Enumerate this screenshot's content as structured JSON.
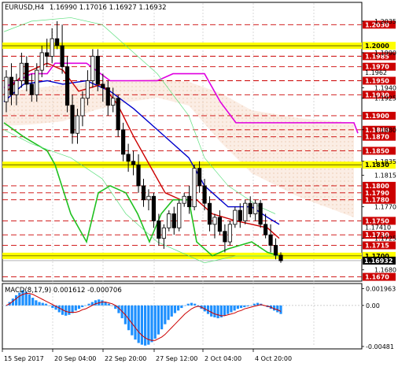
{
  "header": {
    "symbol": "EURUSD,H4",
    "ohlc": "1.16990 1.17016 1.16927 1.16932"
  },
  "price_axis": {
    "ticks": [
      "1.2035",
      "1.1990",
      "1.1940",
      "1.1925",
      "1.1880",
      "1.1835",
      "1.1815",
      "1.1770",
      "1.1725",
      "1.1680"
    ],
    "min": 1.1665,
    "max": 1.2045
  },
  "levels": {
    "red_dashed": [
      1.203,
      1.1985,
      1.197,
      1.195,
      1.193,
      1.19,
      1.188,
      1.187,
      1.185,
      1.18,
      1.179,
      1.178,
      1.175,
      1.173,
      1.1715,
      1.167
    ],
    "yellow_bands": [
      1.2,
      1.183,
      1.17
    ],
    "label_color": "#cc0000",
    "band_color": "#ffff00",
    "current_price": "1.16932",
    "current_price_value": 1.16932,
    "marker_price": "1.1962",
    "marker_price_value": 1.1962,
    "marker_price_2": "1.17410",
    "marker_price_2_value": 1.1741
  },
  "macd": {
    "label": "MACD(8,17,9) 0.001612 -0.000706",
    "axis_ticks": [
      "0.001963",
      "0.00",
      "-0.00481"
    ],
    "hist_color": "#1e90ff",
    "signal_color": "#cc0000",
    "values": [
      0.0,
      0.0004,
      0.0008,
      0.0012,
      0.0015,
      0.0018,
      0.0016,
      0.0013,
      0.0009,
      0.0006,
      0.0004,
      0.0003,
      0.0002,
      0.0,
      -0.0003,
      -0.0005,
      -0.0008,
      -0.0011,
      -0.0012,
      -0.0011,
      -0.0009,
      -0.0006,
      -0.0004,
      -0.0002,
      0.0,
      0.0002,
      0.0004,
      0.0006,
      0.0007,
      0.0006,
      0.0004,
      0.0002,
      0.0,
      -0.0004,
      -0.0009,
      -0.0015,
      -0.0022,
      -0.0029,
      -0.0035,
      -0.004,
      -0.0044,
      -0.0046,
      -0.0047,
      -0.0046,
      -0.0043,
      -0.0039,
      -0.0034,
      -0.0028,
      -0.0022,
      -0.0017,
      -0.0013,
      -0.0009,
      -0.0006,
      -0.0003,
      0.0,
      0.0002,
      0.0003,
      0.0002,
      -0.0001,
      -0.0004,
      -0.0007,
      -0.001,
      -0.0013,
      -0.0014,
      -0.0015,
      -0.0014,
      -0.0012,
      -0.001,
      -0.0008,
      -0.0006,
      -0.0004,
      -0.0003,
      -0.0002,
      -0.0001,
      0.0,
      0.0002,
      0.0003,
      0.0002,
      0.0,
      -0.0002,
      -0.0004,
      -0.0006,
      -0.0008,
      -0.001
    ],
    "signal": [
      0.0,
      0.0002,
      0.0005,
      0.0008,
      0.0011,
      0.0013,
      0.0014,
      0.0014,
      0.0013,
      0.0011,
      0.0009,
      0.0007,
      0.0005,
      0.0003,
      0.0001,
      -0.0001,
      -0.0003,
      -0.0005,
      -0.0007,
      -0.0008,
      -0.0008,
      -0.0008,
      -0.0007,
      -0.0005,
      -0.0004,
      -0.0002,
      0.0,
      0.0002,
      0.0003,
      0.0004,
      0.0004,
      0.0003,
      0.0002,
      0.0,
      -0.0003,
      -0.0007,
      -0.0011,
      -0.0016,
      -0.0021,
      -0.0026,
      -0.0031,
      -0.0035,
      -0.0038,
      -0.004,
      -0.0041,
      -0.0041,
      -0.0039,
      -0.0037,
      -0.0034,
      -0.003,
      -0.0026,
      -0.0022,
      -0.0018,
      -0.0014,
      -0.001,
      -0.0007,
      -0.0004,
      -0.0002,
      -0.0001,
      -0.0002,
      -0.0004,
      -0.0006,
      -0.0008,
      -0.001,
      -0.0011,
      -0.0012,
      -0.0012,
      -0.0011,
      -0.001,
      -0.0009,
      -0.0007,
      -0.0006,
      -0.0004,
      -0.0003,
      -0.0002,
      -0.0001,
      0.0,
      0.0001,
      0.0,
      -0.0001,
      -0.0002,
      -0.0004,
      -0.0005,
      -0.0007
    ],
    "min": -0.005,
    "max": 0.0022
  },
  "time_axis": {
    "labels": [
      "15 Sep 2017",
      "20 Sep 04:00",
      "22 Sep 20:00",
      "27 Sep 12:00",
      "2 Oct 04:00",
      "4 Oct 20:00"
    ]
  },
  "chart_data": {
    "type": "candlestick",
    "symbol": "EURUSD,H4",
    "ylim": [
      1.1665,
      1.2045
    ],
    "candles": [
      [
        1.192,
        1.1965,
        1.1905,
        1.1955
      ],
      [
        1.1955,
        1.1975,
        1.1915,
        1.193
      ],
      [
        1.193,
        1.196,
        1.1915,
        1.195
      ],
      [
        1.195,
        1.199,
        1.194,
        1.1975
      ],
      [
        1.1975,
        1.1985,
        1.1935,
        1.1945
      ],
      [
        1.1945,
        1.196,
        1.192,
        1.193
      ],
      [
        1.193,
        1.1975,
        1.192,
        1.1965
      ],
      [
        1.1965,
        1.2,
        1.1955,
        1.199
      ],
      [
        1.199,
        1.201,
        1.197,
        1.1985
      ],
      [
        1.1985,
        1.2025,
        1.1975,
        1.201
      ],
      [
        1.201,
        1.2035,
        1.1995,
        1.2
      ],
      [
        1.2,
        1.203,
        1.196,
        1.197
      ],
      [
        1.197,
        1.1985,
        1.1905,
        1.1915
      ],
      [
        1.1915,
        1.193,
        1.186,
        1.1875
      ],
      [
        1.1875,
        1.191,
        1.186,
        1.19
      ],
      [
        1.19,
        1.1935,
        1.1885,
        1.1925
      ],
      [
        1.1925,
        1.1965,
        1.1915,
        1.195
      ],
      [
        1.195,
        1.1995,
        1.194,
        1.1985
      ],
      [
        1.1985,
        1.1995,
        1.1935,
        1.1945
      ],
      [
        1.1945,
        1.196,
        1.192,
        1.194
      ],
      [
        1.194,
        1.195,
        1.19,
        1.1915
      ],
      [
        1.1915,
        1.194,
        1.1905,
        1.1925
      ],
      [
        1.1925,
        1.193,
        1.187,
        1.188
      ],
      [
        1.188,
        1.189,
        1.1835,
        1.1845
      ],
      [
        1.1845,
        1.186,
        1.182,
        1.1835
      ],
      [
        1.1835,
        1.185,
        1.1815,
        1.183
      ],
      [
        1.183,
        1.1845,
        1.179,
        1.18
      ],
      [
        1.18,
        1.181,
        1.177,
        1.178
      ],
      [
        1.178,
        1.1795,
        1.1765,
        1.1785
      ],
      [
        1.1785,
        1.179,
        1.174,
        1.175
      ],
      [
        1.175,
        1.176,
        1.1715,
        1.1725
      ],
      [
        1.1725,
        1.1745,
        1.171,
        1.174
      ],
      [
        1.174,
        1.1765,
        1.1735,
        1.176
      ],
      [
        1.176,
        1.177,
        1.173,
        1.174
      ],
      [
        1.174,
        1.178,
        1.1735,
        1.1775
      ],
      [
        1.1775,
        1.179,
        1.177,
        1.1785
      ],
      [
        1.1785,
        1.18,
        1.176,
        1.177
      ],
      [
        1.177,
        1.183,
        1.1765,
        1.1825
      ],
      [
        1.1825,
        1.1835,
        1.179,
        1.18
      ],
      [
        1.18,
        1.181,
        1.1765,
        1.1775
      ],
      [
        1.1775,
        1.1785,
        1.1735,
        1.1745
      ],
      [
        1.1745,
        1.176,
        1.1725,
        1.1755
      ],
      [
        1.1755,
        1.1765,
        1.173,
        1.1735
      ],
      [
        1.1735,
        1.1745,
        1.1705,
        1.172
      ],
      [
        1.172,
        1.175,
        1.1715,
        1.1745
      ],
      [
        1.1745,
        1.177,
        1.174,
        1.1765
      ],
      [
        1.1765,
        1.1775,
        1.174,
        1.175
      ],
      [
        1.175,
        1.178,
        1.1745,
        1.1775
      ],
      [
        1.1775,
        1.1785,
        1.1755,
        1.176
      ],
      [
        1.176,
        1.178,
        1.175,
        1.1775
      ],
      [
        1.1775,
        1.178,
        1.174,
        1.1745
      ],
      [
        1.1745,
        1.176,
        1.1725,
        1.173
      ],
      [
        1.173,
        1.1745,
        1.1705,
        1.1715
      ],
      [
        1.1715,
        1.1725,
        1.1695,
        1.1701
      ],
      [
        1.1701,
        1.1705,
        1.169,
        1.1693
      ]
    ],
    "candle_color": "#000000"
  }
}
